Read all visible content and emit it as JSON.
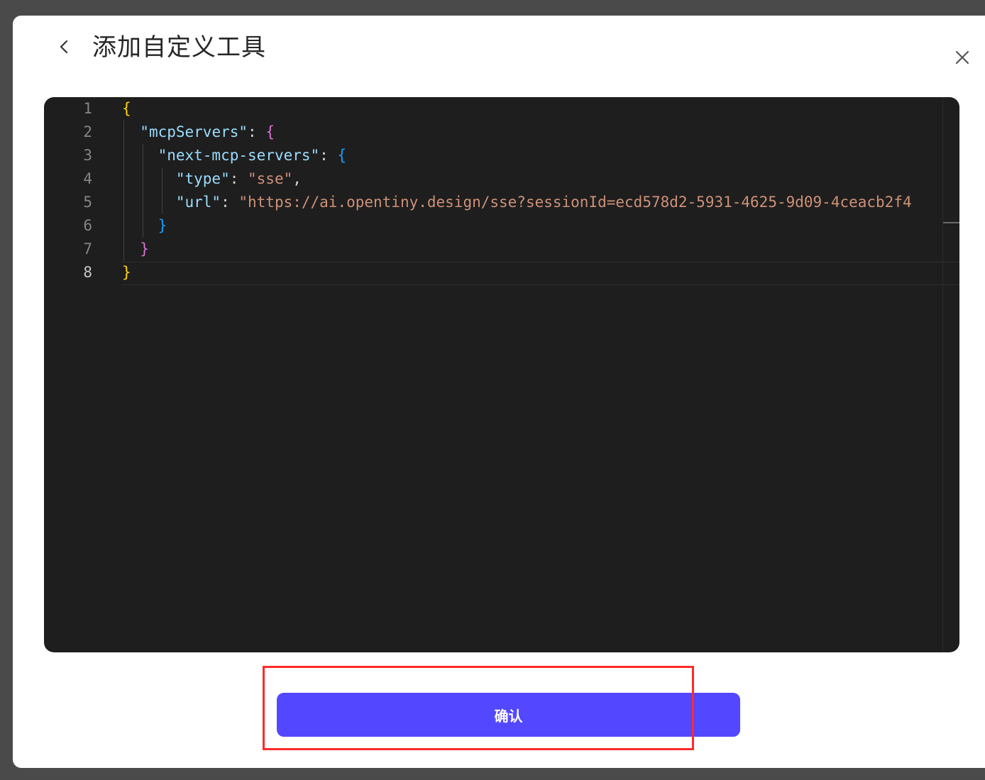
{
  "dialog": {
    "title": "添加自定义工具",
    "back_icon": "chevron-left-icon",
    "close_icon": "close-icon"
  },
  "editor": {
    "line_numbers": [
      "1",
      "2",
      "3",
      "4",
      "5",
      "6",
      "7",
      "8"
    ],
    "active_line": "8",
    "json": {
      "root_key": "\"mcpServers\"",
      "server_key": "\"next-mcp-servers\"",
      "type_key": "\"type\"",
      "type_value": "\"sse\"",
      "url_key": "\"url\"",
      "url_value": "\"https://ai.opentiny.design/sse?sessionId=ecd578d2-5931-4625-9d09-4ceacb2f4"
    },
    "colors": {
      "background": "#1e1e1e",
      "key": "#9cdcfe",
      "string": "#ce9178",
      "bracket_level1": "#ffd700",
      "bracket_level2": "#da70d6",
      "bracket_level3": "#179fff"
    }
  },
  "footer": {
    "confirm_label": "确认",
    "confirm_color": "#5347ff",
    "highlight_color": "#ff2a2a"
  }
}
